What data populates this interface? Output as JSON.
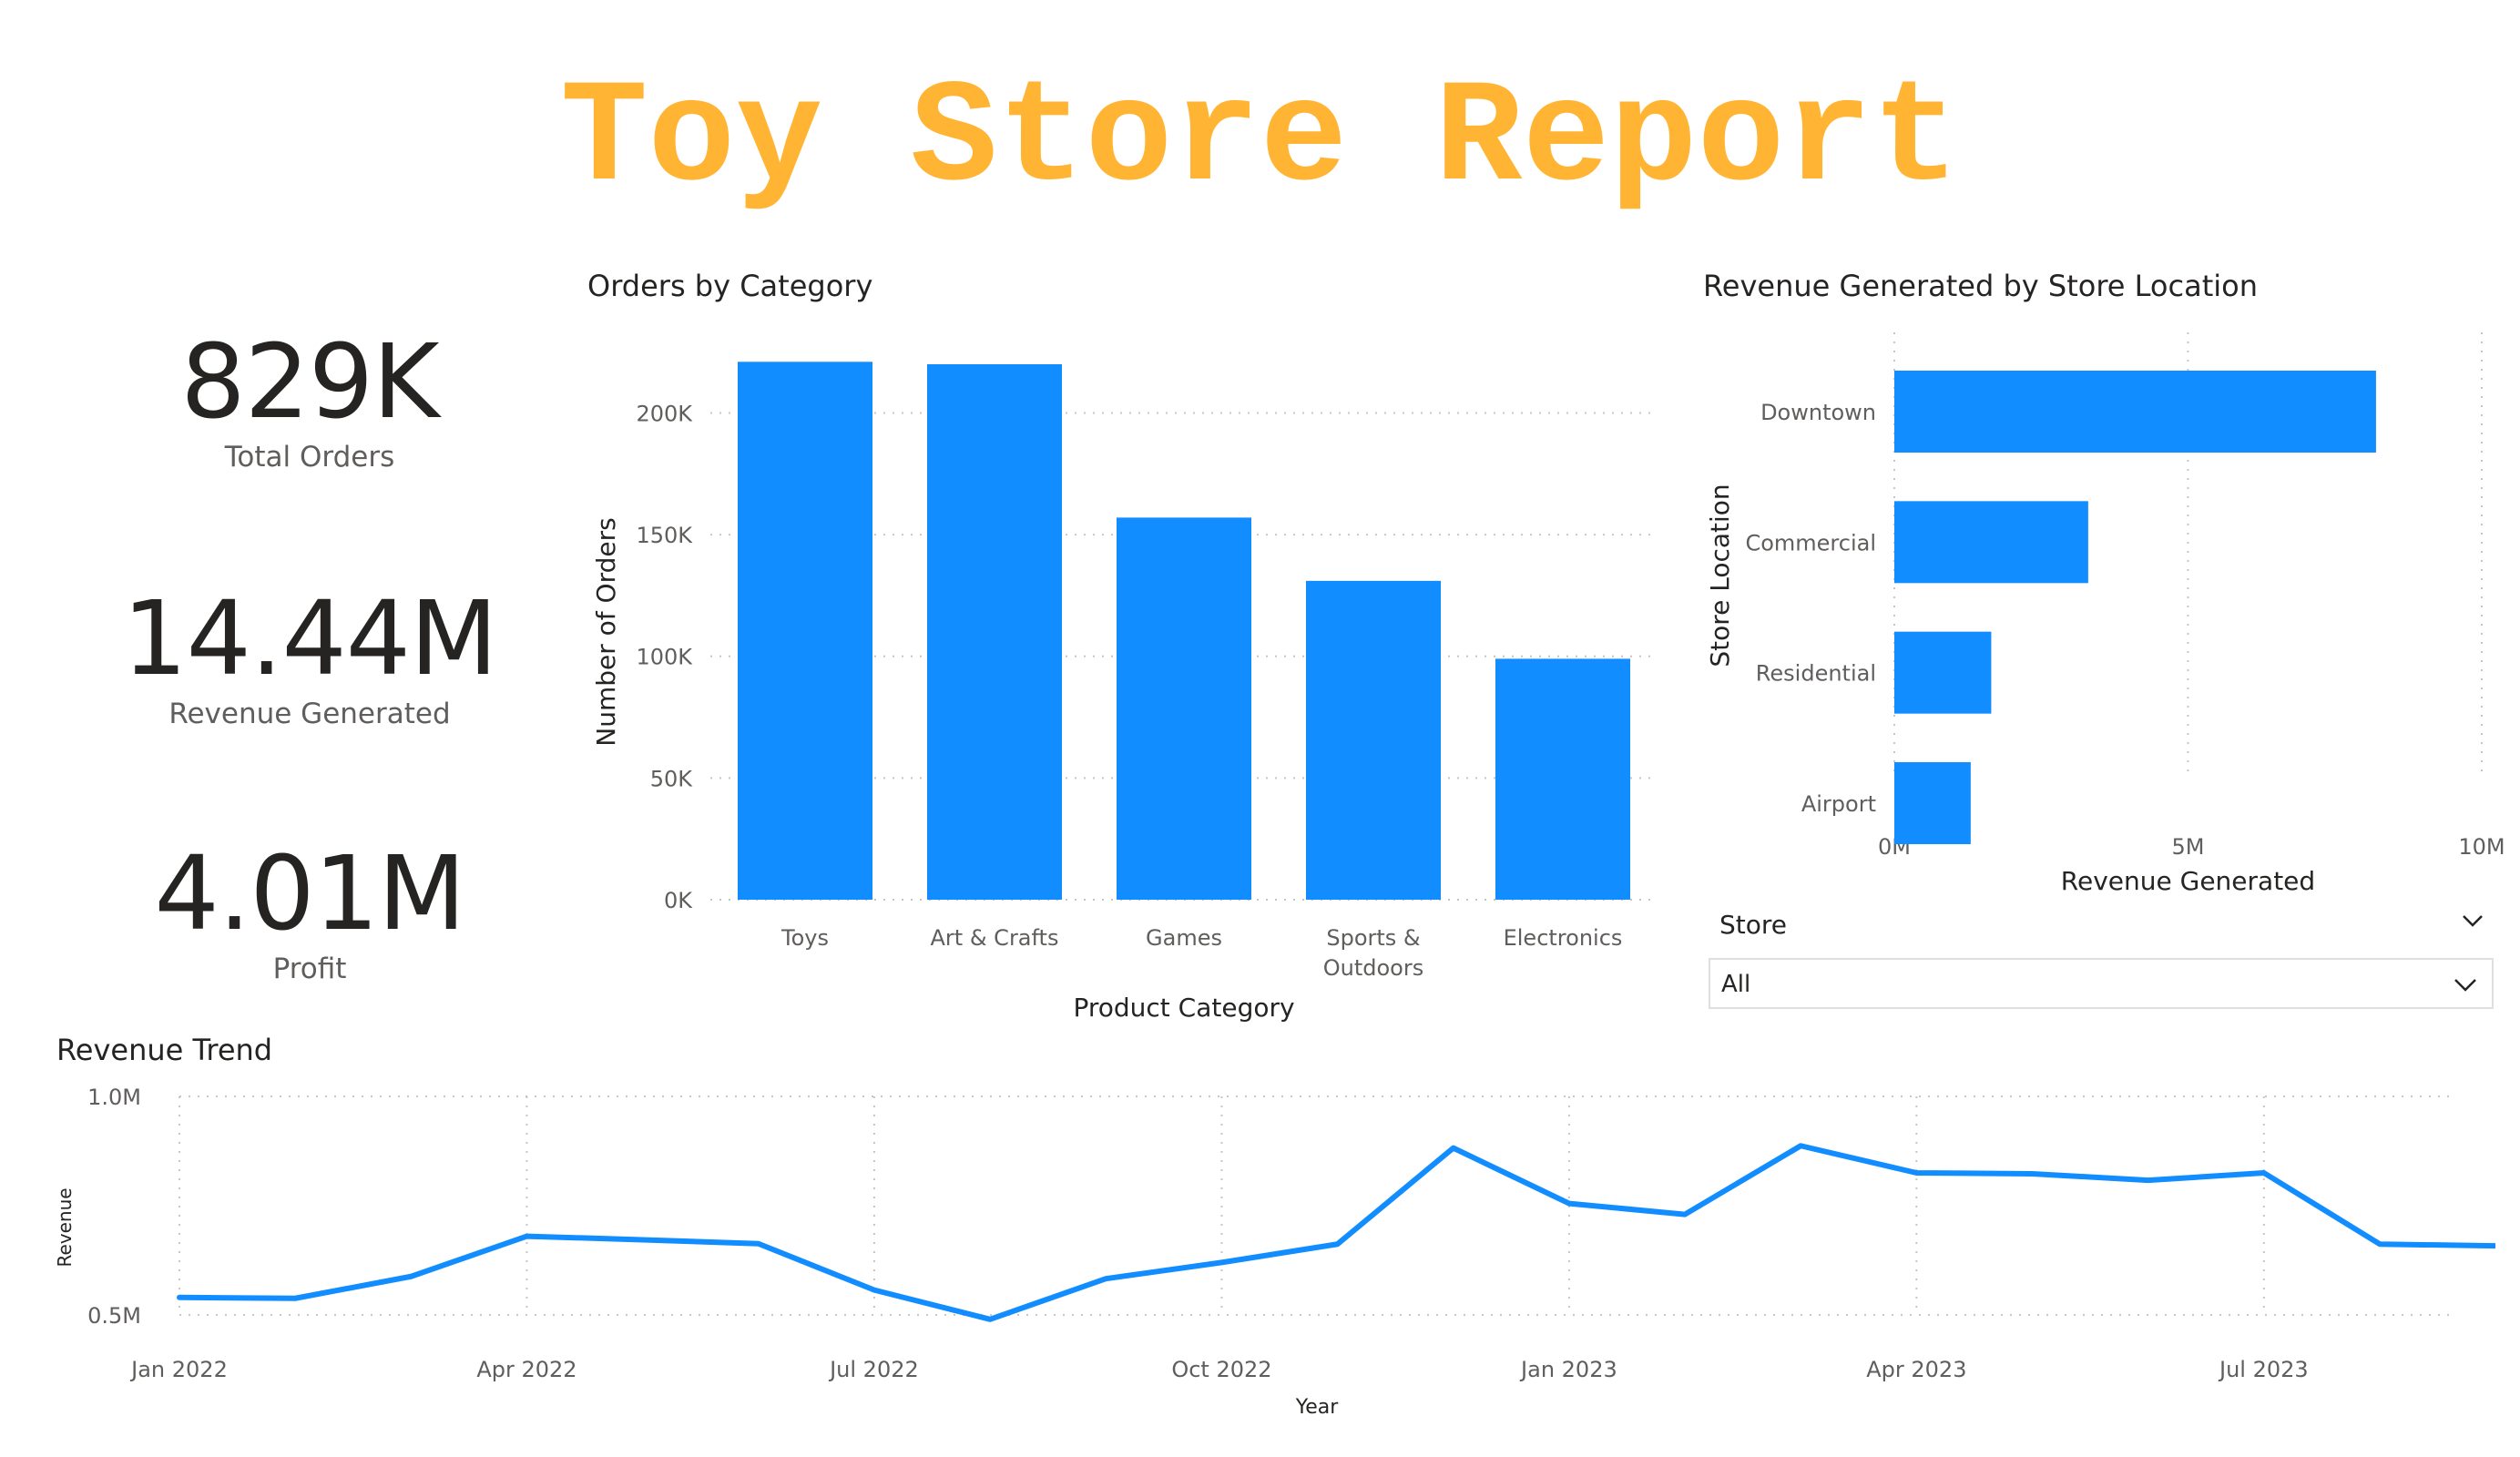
{
  "title": "Toy Store Report",
  "colors": {
    "title": "#ffb533",
    "bar": "#118dff",
    "line": "#118dff",
    "grid": "#c8c6c4",
    "kpi": "#252423"
  },
  "kpis": [
    {
      "value": "829K",
      "label": "Total Orders"
    },
    {
      "value": "14.44M",
      "label": "Revenue Generated"
    },
    {
      "value": "4.01M",
      "label": "Profit"
    }
  ],
  "slicer": {
    "label": "Store",
    "value": "All",
    "header_icon": "chevron-down-icon",
    "dropdown_icon": "chevron-down-icon"
  },
  "chart_data": [
    {
      "type": "bar",
      "title": "Orders by Category",
      "xlabel": "Product Category",
      "ylabel": "Number of Orders",
      "categories": [
        "Toys",
        "Art & Crafts",
        "Games",
        "Sports & Outdoors",
        "Electronics"
      ],
      "values": [
        221000,
        220000,
        157000,
        131000,
        99000
      ],
      "ylim": [
        0,
        220000
      ],
      "yticks": [
        0,
        50000,
        100000,
        150000,
        200000
      ],
      "yticklabels": [
        "0K",
        "50K",
        "100K",
        "150K",
        "200K"
      ],
      "grid": true
    },
    {
      "type": "bar",
      "orientation": "horizontal",
      "title": "Revenue Generated by Store Location",
      "xlabel": "Revenue Generated",
      "ylabel": "Store Location",
      "categories": [
        "Downtown",
        "Commercial",
        "Residential",
        "Airport"
      ],
      "values": [
        8200000,
        3300000,
        1650000,
        1300000
      ],
      "xlim": [
        0,
        10000000
      ],
      "xticks": [
        0,
        5000000,
        10000000
      ],
      "xticklabels": [
        "0M",
        "5M",
        "10M"
      ],
      "grid": true
    },
    {
      "type": "line",
      "title": "Revenue Trend",
      "xlabel": "Year",
      "ylabel": "Revenue",
      "x": [
        "2022-01",
        "2022-02",
        "2022-03",
        "2022-04",
        "2022-05",
        "2022-06",
        "2022-07",
        "2022-08",
        "2022-09",
        "2022-10",
        "2022-11",
        "2022-12",
        "2023-01",
        "2023-02",
        "2023-03",
        "2023-04",
        "2023-05",
        "2023-06",
        "2023-07",
        "2023-08",
        "2023-09"
      ],
      "values": [
        540000,
        538000,
        588000,
        680000,
        672000,
        663000,
        557000,
        490000,
        583000,
        620000,
        662000,
        882000,
        755000,
        730000,
        887000,
        825000,
        823000,
        808000,
        825000,
        662000,
        658000
      ],
      "ylim": [
        0.45,
        1.0
      ],
      "yticks": [
        500000,
        1000000
      ],
      "yticklabels": [
        "0.5M",
        "1.0M"
      ],
      "xticklabels": [
        "Jan 2022",
        "Apr 2022",
        "Jul 2022",
        "Oct 2022",
        "Jan 2023",
        "Apr 2023",
        "Jul 2023"
      ],
      "grid": true
    }
  ]
}
